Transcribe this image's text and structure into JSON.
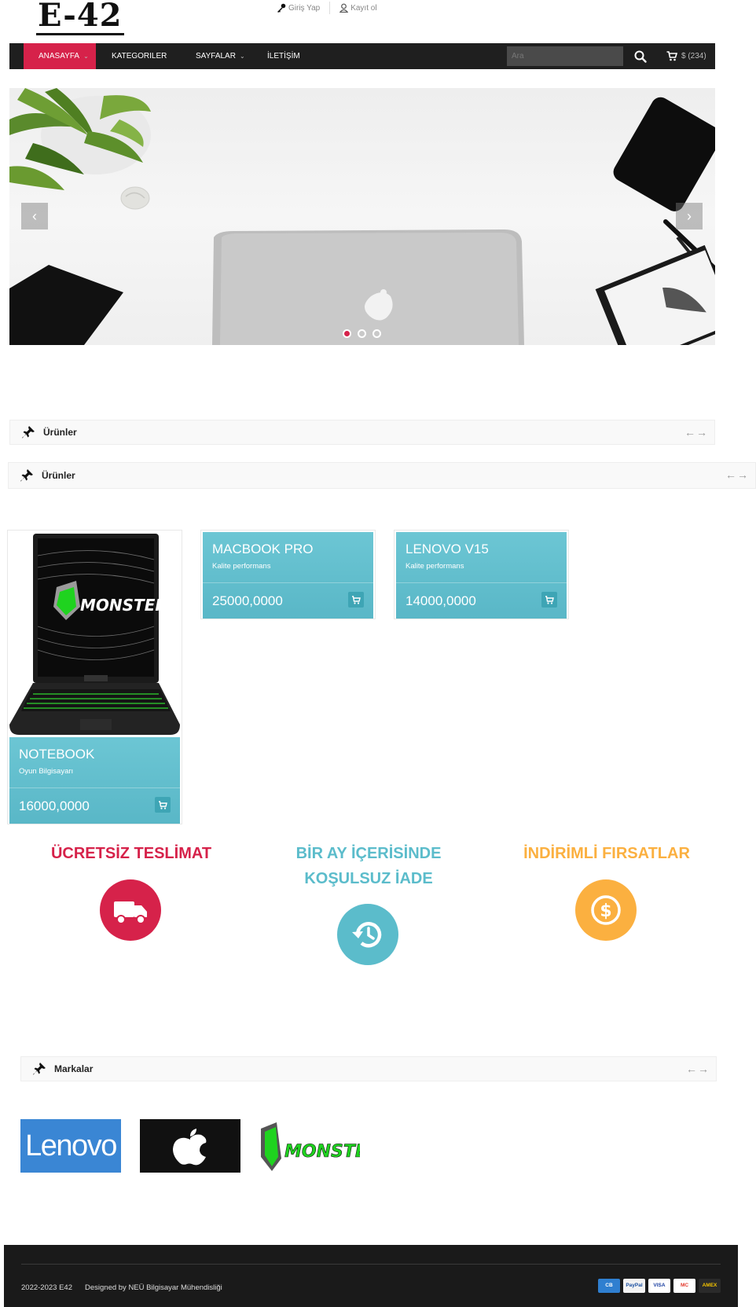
{
  "header": {
    "logo": "E-42",
    "login_label": "Giriş Yap",
    "register_label": "Kayıt ol"
  },
  "nav": {
    "items": [
      {
        "label": "ANASAYFA",
        "active": true,
        "dropdown": true
      },
      {
        "label": "KATEGORILER",
        "active": false,
        "dropdown": false
      },
      {
        "label": "SAYFALAR",
        "active": false,
        "dropdown": true
      },
      {
        "label": "İLETİŞİM",
        "active": false,
        "dropdown": false
      }
    ],
    "search_placeholder": "Ara",
    "cart_label": "$ (234)",
    "icons": {
      "search": "search-icon",
      "cart": "cart-icon"
    }
  },
  "slider": {
    "prev": "‹",
    "next": "›",
    "dots": 3,
    "active_dot": 1
  },
  "sections": {
    "products_1": {
      "title": "Ürünler",
      "arrows": "←→"
    },
    "products_2": {
      "title": "Ürünler",
      "arrows": "←→"
    },
    "brands": {
      "title": "Markalar",
      "arrows": "←→"
    }
  },
  "products": [
    {
      "name": "NOTEBOOK",
      "desc": "Oyun Bilgisayarı",
      "price": "16000,0000",
      "image_logo": "MONSTER"
    },
    {
      "name": "MACBOOK PRO",
      "desc": "Kalite performans",
      "price": "25000,0000"
    },
    {
      "name": "LENOVO V15",
      "desc": "Kalite performans",
      "price": "14000,0000"
    }
  ],
  "features": [
    {
      "title": "ÜCRETSİZ TESLİMAT",
      "color": "#d6224a",
      "icon": "truck-icon"
    },
    {
      "title_line1": "BİR AY İÇERİSİNDE",
      "title_line2": "KOŞULSUZ İADE",
      "color": "#5bbccb",
      "icon": "history-icon"
    },
    {
      "title": "İNDİRİMLİ FIRSATLAR",
      "color": "#fbb040",
      "icon": "dollar-icon"
    }
  ],
  "brands": [
    {
      "name": "Lenovo",
      "bg": "#3a86d4"
    },
    {
      "name": "Apple",
      "bg": "#111111"
    },
    {
      "name": "MONSTER",
      "bg": "#ffffff"
    }
  ],
  "footer": {
    "copyright": "2022-2023 E42",
    "credit": "Designed by NEÜ Bilgisayar Mühendisliği",
    "payments": [
      "CB",
      "PayPal",
      "VISA",
      "MC",
      "AMEX"
    ]
  },
  "colors": {
    "accent": "#d6224a",
    "teal": "#5bbccb",
    "orange": "#fbb040",
    "navbar": "#1f1f1f",
    "footer": "#1a1a1a"
  }
}
